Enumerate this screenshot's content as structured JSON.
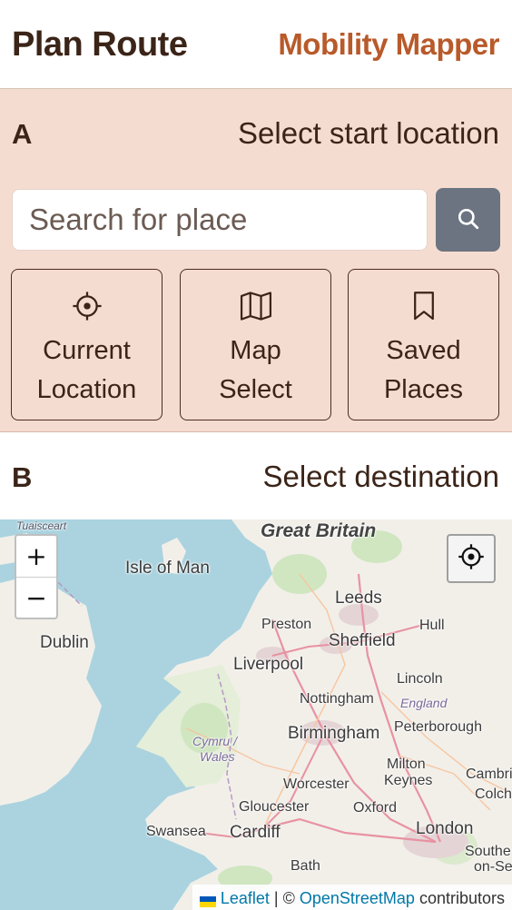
{
  "header": {
    "title": "Plan Route",
    "brand": "Mobility Mapper"
  },
  "step_a": {
    "letter": "A",
    "label": "Select start location",
    "search_placeholder": "Search for place",
    "options": [
      {
        "icon": "crosshair-icon",
        "line1": "Current",
        "line2": "Location"
      },
      {
        "icon": "map-icon",
        "line1": "Map",
        "line2": "Select"
      },
      {
        "icon": "bookmark-icon",
        "line1": "Saved",
        "line2": "Places"
      }
    ]
  },
  "step_b": {
    "letter": "B",
    "label": "Select destination"
  },
  "map": {
    "zoom_in": "+",
    "zoom_out": "−",
    "labels": {
      "tuaisceart": "Tuaisceart",
      "great_britain": "Great Britain",
      "isle_of_man": "Isle of Man",
      "leeds": "Leeds",
      "preston": "Preston",
      "hull": "Hull",
      "dublin": "Dublin",
      "sheffield": "Sheffield",
      "liverpool": "Liverpool",
      "lincoln": "Lincoln",
      "nottingham": "Nottingham",
      "england": "England",
      "birmingham": "Birmingham",
      "peterborough": "Peterborough",
      "cymru": "Cymru /",
      "wales": "Wales",
      "milton": "Milton",
      "keynes": "Keynes",
      "cambr": "Cambri",
      "worcester": "Worcester",
      "colch": "Colch",
      "gloucester": "Gloucester",
      "oxford": "Oxford",
      "swansea": "Swansea",
      "cardiff": "Cardiff",
      "london": "London",
      "southe": "Southe",
      "on_se": "on-Se",
      "bath": "Bath"
    },
    "attribution": {
      "leaflet": "Leaflet",
      "sep": " | © ",
      "osm": "OpenStreetMap",
      "suffix": " contributors"
    }
  },
  "colors": {
    "accent": "#b85a2a",
    "section_bg": "#f5dcd1",
    "text": "#3b2418",
    "search_button": "#6b7480"
  }
}
